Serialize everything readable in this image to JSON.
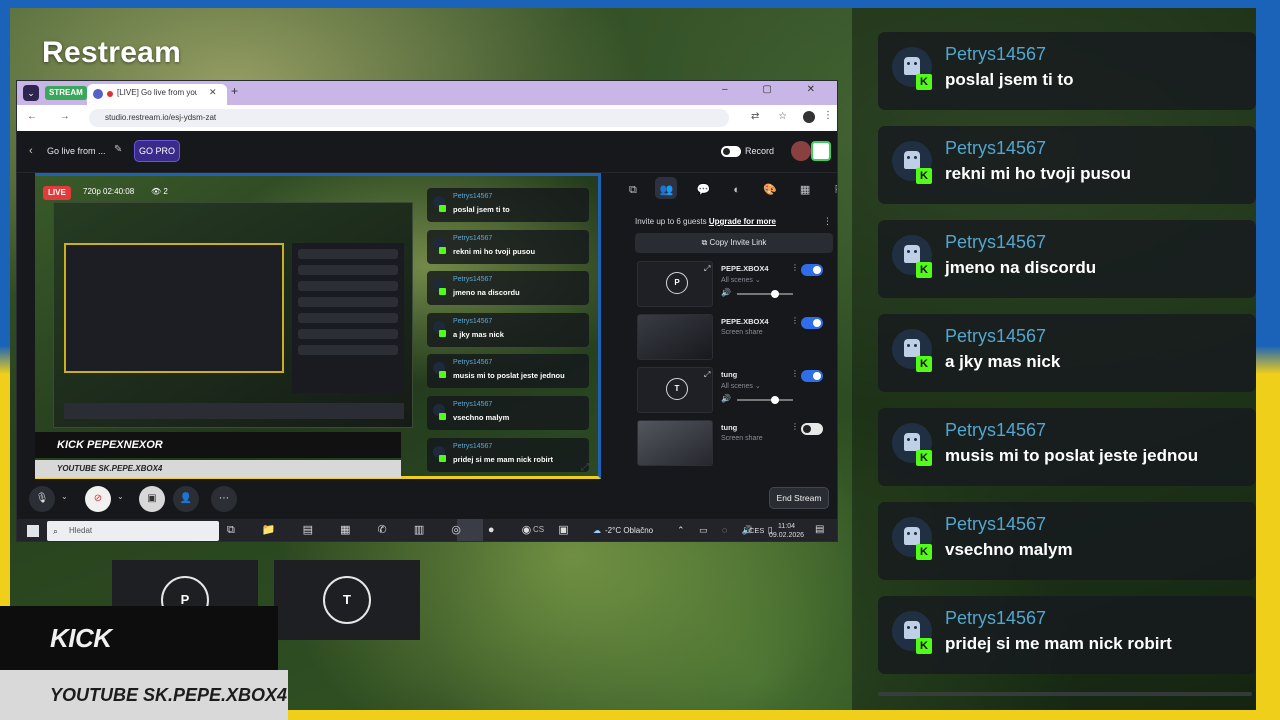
{
  "overlay": {
    "brand": "Restream",
    "kick_tag": "KICK PEPEXNEXOR",
    "youtube_tag": "YOUTUBE SK.PEPE.XBOX4"
  },
  "colors": {
    "flag_blue": "#1a63b8",
    "flag_yellow": "#f0cf1a",
    "kick_green": "#53fc18",
    "username_blue": "#53a6cf"
  },
  "browser": {
    "tab_stream_badge": "STREAM",
    "tab_title": "[LIVE] Go live from you",
    "url": "studio.restream.io/esj-ydsm-zat",
    "window_controls": "–  ▢  ✕"
  },
  "studio": {
    "back_label": "Go live from ...",
    "go_pro": "GO PRO",
    "record_label": "Record",
    "live_badge": "LIVE",
    "live_meta": "720p  02:40:08",
    "viewer_count": "2",
    "invite_text": "Invite up to 6 guests",
    "upgrade_link": "Upgrade for more",
    "copy_invite": "Copy Invite Link",
    "guests": [
      {
        "thumb_letter": "P",
        "name": "PEPE.XBOX4",
        "sub": "All scenes ⌄",
        "enabled": true,
        "has_volume": true
      },
      {
        "thumb_letter": "",
        "name": "PEPE.XBOX4",
        "sub": "Screen share",
        "enabled": true,
        "has_volume": false
      },
      {
        "thumb_letter": "T",
        "name": "tung",
        "sub": "All scenes ⌄",
        "enabled": true,
        "has_volume": true
      },
      {
        "thumb_letter": "",
        "name": "tung",
        "sub": "Screen share",
        "enabled": false,
        "has_volume": false
      }
    ],
    "preview_kick": "KICK PEPEXNEXOR",
    "preview_youtube": "YOUTUBE SK.PEPE.XBOX4",
    "end_stream": "End Stream"
  },
  "taskbar": {
    "search_placeholder": "Hledat",
    "cs_label": "CS",
    "weather": "-2°C  Oblačno",
    "lang": "CES",
    "time": "11:04",
    "date": "09.02.2026"
  },
  "tiles": {
    "p_letter": "P",
    "t_letter": "T"
  },
  "chat": [
    {
      "user": "Petrys14567",
      "text": "poslal jsem ti to"
    },
    {
      "user": "Petrys14567",
      "text": "rekni mi ho tvoji pusou"
    },
    {
      "user": "Petrys14567",
      "text": "jmeno na discordu"
    },
    {
      "user": "Petrys14567",
      "text": "a jky mas nick"
    },
    {
      "user": "Petrys14567",
      "text": "musis mi to poslat jeste jednou"
    },
    {
      "user": "Petrys14567",
      "text": "vsechno malym"
    },
    {
      "user": "Petrys14567",
      "text": "pridej si me mam nick robirt"
    }
  ]
}
